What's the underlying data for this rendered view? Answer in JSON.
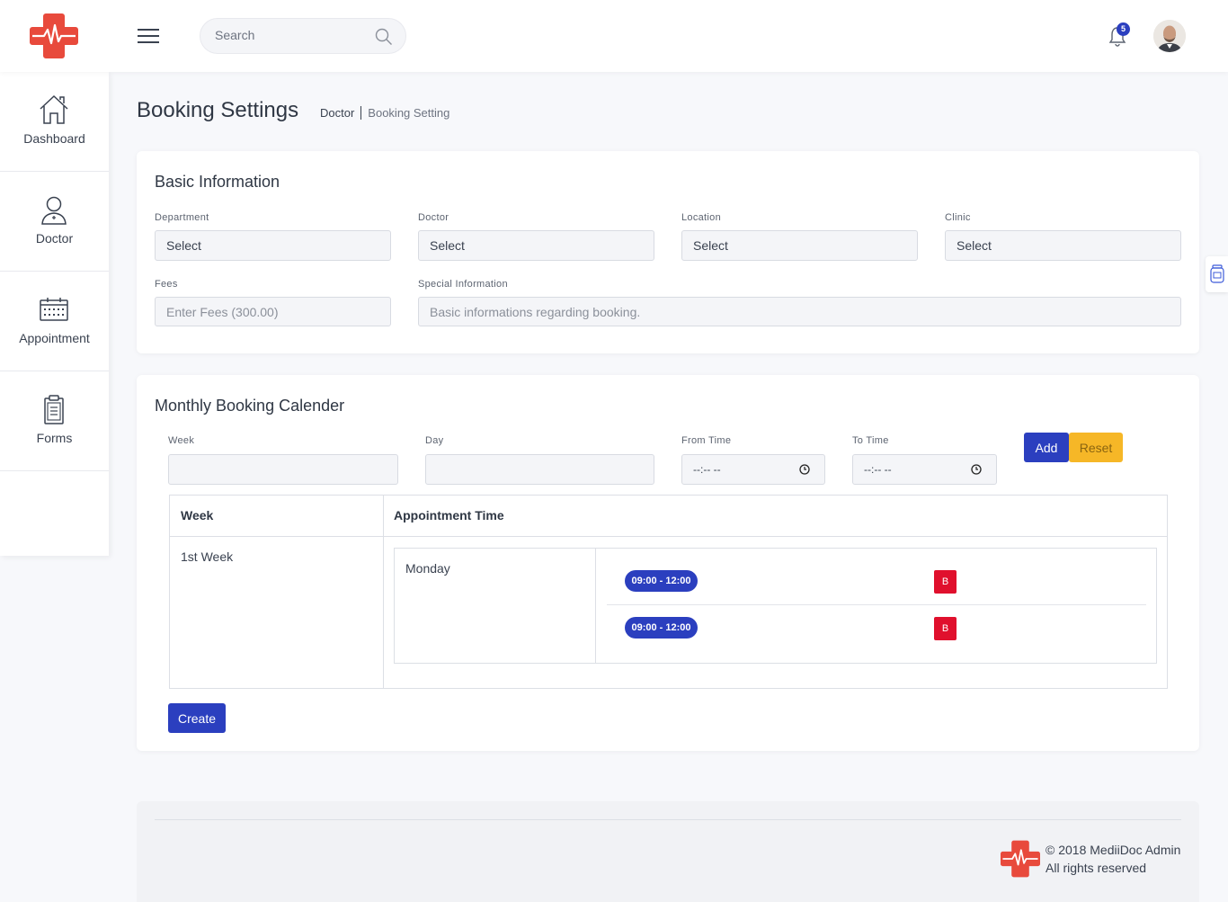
{
  "header": {
    "search_placeholder": "Search",
    "notification_count": "5"
  },
  "sidebar": {
    "items": [
      {
        "label": "Dashboard",
        "icon": "home-icon"
      },
      {
        "label": "Doctor",
        "icon": "doctor-icon"
      },
      {
        "label": "Appointment",
        "icon": "calendar-icon"
      },
      {
        "label": "Forms",
        "icon": "clipboard-icon"
      }
    ]
  },
  "page": {
    "title": "Booking Settings",
    "breadcrumb": [
      "Doctor",
      "Booking Setting"
    ]
  },
  "basic_info": {
    "title": "Basic Information",
    "department_label": "Department",
    "department_value": "Select",
    "doctor_label": "Doctor",
    "doctor_value": "Select",
    "location_label": "Location",
    "location_value": "Select",
    "clinic_label": "Clinic",
    "clinic_value": "Select",
    "fees_label": "Fees",
    "fees_placeholder": "Enter Fees (300.00)",
    "special_label": "Special Information",
    "special_placeholder": "Basic informations regarding booking."
  },
  "calendar": {
    "title": "Monthly Booking Calender",
    "week_label": "Week",
    "day_label": "Day",
    "from_label": "From Time",
    "from_value": "--:-- --",
    "to_label": "To Time",
    "to_value": "--:-- --",
    "add_label": "Add",
    "reset_label": "Reset",
    "table": {
      "col_week": "Week",
      "col_time": "Appointment Time",
      "week_value": "1st Week",
      "day_value": "Monday",
      "slots": [
        "09:00 - 12:00",
        "09:00 - 12:00"
      ],
      "slot_action": "B"
    },
    "create_label": "Create"
  },
  "footer": {
    "copyright": "© 2018 MediiDoc Admin",
    "rights": "All rights reserved"
  },
  "colors": {
    "brand_red": "#e84a3c",
    "primary_blue": "#2b3fbf",
    "warning_yellow": "#f6b727",
    "danger_red": "#e0102d"
  }
}
